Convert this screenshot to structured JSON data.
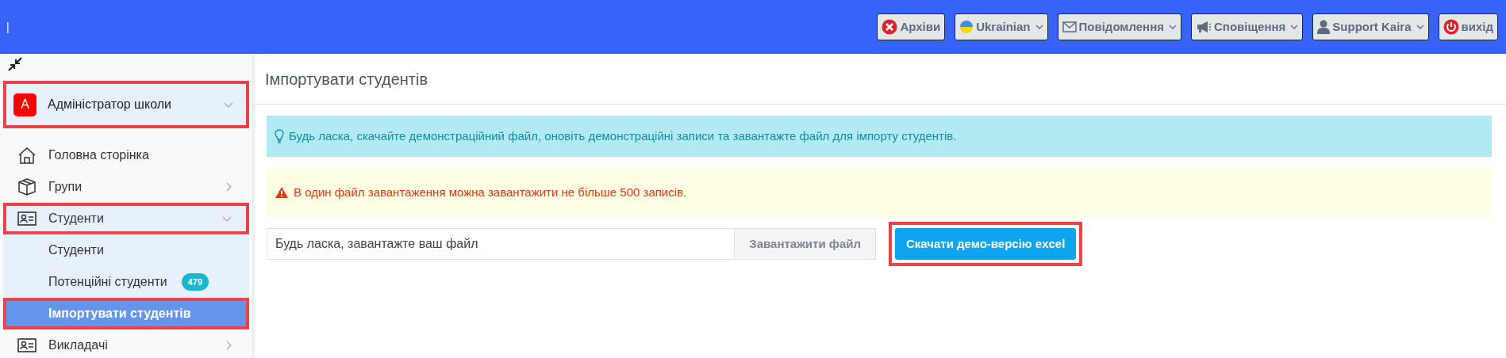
{
  "topbar": {
    "left_text": "|",
    "buttons": [
      {
        "kind": "archive",
        "label": "Архіви",
        "dropdown": false
      },
      {
        "kind": "language",
        "label": "Ukrainian",
        "dropdown": true
      },
      {
        "kind": "messages",
        "label": "Повідомлення",
        "dropdown": true
      },
      {
        "kind": "notifications",
        "label": "Сповіщення",
        "dropdown": true
      },
      {
        "kind": "user",
        "label": "Support Kaira",
        "dropdown": true
      },
      {
        "kind": "logout",
        "label": "вихід",
        "dropdown": false
      }
    ]
  },
  "sidebar": {
    "profile": {
      "initial": "А",
      "name": "Адміністратор школи",
      "highlighted": true
    },
    "items": [
      {
        "kind": "home",
        "label": "Головна сторінка",
        "selected": false,
        "highlighted": false
      },
      {
        "kind": "groups",
        "label": "Групи",
        "expanded": false,
        "selected": false,
        "highlighted": false
      },
      {
        "kind": "students",
        "label": "Студенти",
        "expanded": true,
        "selected": false,
        "highlighted": true
      },
      {
        "kind": "subitem",
        "label": "Студенти",
        "selected": false,
        "highlighted": false
      },
      {
        "kind": "subitem",
        "label": "Потенційні студенти",
        "badge": "479",
        "selected": false,
        "highlighted": false
      },
      {
        "kind": "subitem",
        "label": "Імпортувати студентів",
        "selected": true,
        "highlighted": true
      },
      {
        "kind": "teachers",
        "label": "Викладачі",
        "expanded": false,
        "selected": false,
        "highlighted": false
      }
    ]
  },
  "page": {
    "title": "Імпортувати студентів",
    "alerts": [
      {
        "kind": "info",
        "text": "Будь ласка, скачайте демонстраційний файл, оновіть демонстраційні записи та завантажте файл для імпорту студентів."
      },
      {
        "kind": "warning",
        "text": "В один файл завантаження можна завантажити не більше 500 записів."
      }
    ],
    "file_input": {
      "placeholder": "Будь ласка, завантажте ваш файл",
      "button": "Завантажити файл"
    },
    "download_button": {
      "label": "Скачати демо-версію excel",
      "highlighted": true
    }
  }
}
